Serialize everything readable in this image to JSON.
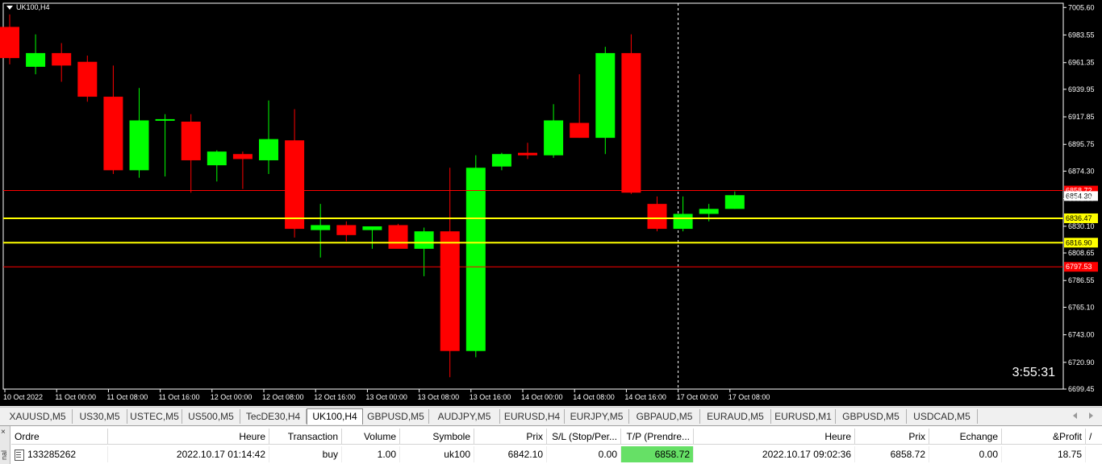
{
  "symbol": "UK100,H4",
  "countdown": "3:55:31",
  "colors": {
    "bull": "#00ff00",
    "bear": "#ff0000",
    "background": "#000000",
    "level_red": "#ff0000",
    "level_yellow": "#ffff00",
    "tp_highlight": "#66e066"
  },
  "chart_data": {
    "type": "candlestick",
    "timeframe": "H4",
    "ylim": [
      6699.45,
      7009.0
    ],
    "y_ticks": [
      "7005.60",
      "6983.55",
      "6961.35",
      "6939.95",
      "6917.85",
      "6895.75",
      "6874.30",
      "6852.30",
      "6830.10",
      "6808.65",
      "6786.55",
      "6765.10",
      "6743.00",
      "6720.90",
      "6699.45"
    ],
    "x_labels": [
      "10 Oct 2022",
      "11 Oct 00:00",
      "11 Oct 08:00",
      "11 Oct 16:00",
      "12 Oct 00:00",
      "12 Oct 08:00",
      "12 Oct 16:00",
      "13 Oct 00:00",
      "13 Oct 08:00",
      "13 Oct 16:00",
      "14 Oct 00:00",
      "14 Oct 08:00",
      "14 Oct 16:00",
      "17 Oct 00:00",
      "17 Oct 08:00"
    ],
    "candles": [
      {
        "o": 6990,
        "h": 7000,
        "l": 6960,
        "c": 6965
      },
      {
        "o": 6958,
        "h": 6984,
        "l": 6952,
        "c": 6969
      },
      {
        "o": 6969,
        "h": 6977,
        "l": 6946,
        "c": 6959
      },
      {
        "o": 6962,
        "h": 6967,
        "l": 6930,
        "c": 6934
      },
      {
        "o": 6934,
        "h": 6959,
        "l": 6872,
        "c": 6875
      },
      {
        "o": 6875,
        "h": 6941,
        "l": 6869,
        "c": 6915
      },
      {
        "o": 6916,
        "h": 6920,
        "l": 6870,
        "c": 6916
      },
      {
        "o": 6914,
        "h": 6920,
        "l": 6857,
        "c": 6883
      },
      {
        "o": 6879,
        "h": 6891,
        "l": 6866,
        "c": 6890
      },
      {
        "o": 6888,
        "h": 6890,
        "l": 6860,
        "c": 6884
      },
      {
        "o": 6883,
        "h": 6931,
        "l": 6872,
        "c": 6900
      },
      {
        "o": 6899,
        "h": 6924,
        "l": 6821,
        "c": 6828
      },
      {
        "o": 6827,
        "h": 6848,
        "l": 6805,
        "c": 6831
      },
      {
        "o": 6831,
        "h": 6834,
        "l": 6818,
        "c": 6823
      },
      {
        "o": 6827,
        "h": 6830,
        "l": 6812,
        "c": 6830
      },
      {
        "o": 6831,
        "h": 6832,
        "l": 6815,
        "c": 6812
      },
      {
        "o": 6812,
        "h": 6829,
        "l": 6790,
        "c": 6826
      },
      {
        "o": 6826,
        "h": 6877,
        "l": 6709,
        "c": 6730
      },
      {
        "o": 6730,
        "h": 6887,
        "l": 6725,
        "c": 6877
      },
      {
        "o": 6878,
        "h": 6889,
        "l": 6875,
        "c": 6888
      },
      {
        "o": 6889,
        "h": 6897,
        "l": 6884,
        "c": 6887
      },
      {
        "o": 6887,
        "h": 6928,
        "l": 6885,
        "c": 6915
      },
      {
        "o": 6913,
        "h": 6952,
        "l": 6901,
        "c": 6901
      },
      {
        "o": 6901,
        "h": 6974,
        "l": 6888,
        "c": 6969
      },
      {
        "o": 6969,
        "h": 6984,
        "l": 6856,
        "c": 6857
      },
      {
        "o": 6848,
        "h": 6854,
        "l": 6826,
        "c": 6828
      },
      {
        "o": 6828,
        "h": 6854,
        "l": 6826,
        "c": 6840
      },
      {
        "o": 6840,
        "h": 6848,
        "l": 6834,
        "c": 6844
      },
      {
        "o": 6844,
        "h": 6858,
        "l": 6844,
        "c": 6855
      }
    ],
    "levels": [
      {
        "price": 6858.72,
        "label": "6858.72",
        "color": "red"
      },
      {
        "price": 6836.47,
        "label": "6836.47",
        "color": "yellow"
      },
      {
        "price": 6816.9,
        "label": "6816.90",
        "color": "yellow"
      },
      {
        "price": 6797.53,
        "label": "6797.53",
        "color": "red"
      }
    ],
    "current_price": "6854.30"
  },
  "tabs": [
    {
      "label": "XAUUSD,M5"
    },
    {
      "label": "US30,M5"
    },
    {
      "label": "USTEC,M5"
    },
    {
      "label": "US500,M5"
    },
    {
      "label": "TecDE30,H4"
    },
    {
      "label": "UK100,H4",
      "active": true
    },
    {
      "label": "GBPUSD,M5"
    },
    {
      "label": "AUDJPY,M5"
    },
    {
      "label": "EURUSD,H4"
    },
    {
      "label": "EURJPY,M5"
    },
    {
      "label": "GBPAUD,M5"
    },
    {
      "label": "EURAUD,M5"
    },
    {
      "label": "EURUSD,M1"
    },
    {
      "label": "GBPUSD,M5"
    },
    {
      "label": "USDCAD,M5"
    }
  ],
  "terminal": {
    "side_label": "nal",
    "close_glyph": "×",
    "headers": [
      "Ordre",
      "Heure",
      "Transaction",
      "Volume",
      "Symbole",
      "Prix",
      "S/L (Stop/Per...",
      "T/P (Prendre...",
      "Heure",
      "Prix",
      "Echange",
      "&Profit"
    ],
    "sort_glyph": "/",
    "row": [
      "133285262",
      "2022.10.17 01:14:42",
      "buy",
      "1.00",
      "uk100",
      "6842.10",
      "0.00",
      "6858.72",
      "2022.10.17 09:02:36",
      "6858.72",
      "0.00",
      "18.75"
    ]
  }
}
